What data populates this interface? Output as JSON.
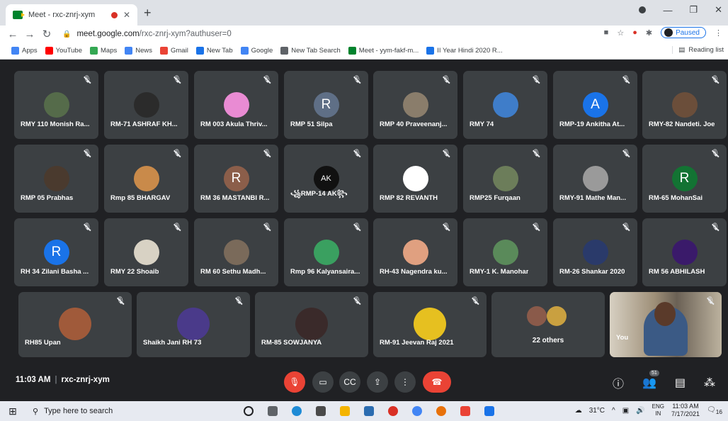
{
  "browser": {
    "tab_title": "Meet - rxc-znrj-xym",
    "url_host": "meet.google.com",
    "url_path": "/rxc-znrj-xym?authuser=0",
    "profile_status": "Paused",
    "bookmarks": [
      {
        "label": "Apps",
        "color": "#4285f4"
      },
      {
        "label": "YouTube",
        "color": "#ff0000"
      },
      {
        "label": "Maps",
        "color": "#34a853"
      },
      {
        "label": "News",
        "color": "#4285f4"
      },
      {
        "label": "Gmail",
        "color": "#ea4335"
      },
      {
        "label": "New Tab",
        "color": "#1a73e8"
      },
      {
        "label": "Google",
        "color": "#4285f4"
      },
      {
        "label": "New Tab Search",
        "color": "#5f6368"
      },
      {
        "label": "Meet - yym-fakf-m...",
        "color": "#00832d"
      },
      {
        "label": "II Year Hindi 2020 R...",
        "color": "#1a73e8"
      }
    ],
    "reading_list": "Reading list"
  },
  "participants": [
    {
      "name": "RMY 110 Monish Ra...",
      "avatar_color": "#556b4a",
      "letter": ""
    },
    {
      "name": "RM-71 ASHRAF KH...",
      "avatar_color": "#2b2b2b",
      "letter": ""
    },
    {
      "name": "RM 003 Akula Thriv...",
      "avatar_color": "#e98bd3",
      "letter": ""
    },
    {
      "name": "RMP 51 Silpa",
      "avatar_color": "#5f6f86",
      "letter": "R"
    },
    {
      "name": "RMP 40 Praveenanj...",
      "avatar_color": "#8a7d6b",
      "letter": ""
    },
    {
      "name": "RMY 74",
      "avatar_color": "#3f7dc9",
      "letter": ""
    },
    {
      "name": "RMP-19 Ankitha At...",
      "avatar_color": "#1a73e8",
      "letter": "A"
    },
    {
      "name": "RMY-82 Nandeti. Joe",
      "avatar_color": "#6b4e3a",
      "letter": ""
    },
    {
      "name": "RMP 05 Prabhas",
      "avatar_color": "#4a3a2e",
      "letter": ""
    },
    {
      "name": "Rmp 85 BHARGAV",
      "avatar_color": "#c98a4a",
      "letter": ""
    },
    {
      "name": "RM 36 MASTANBI R...",
      "avatar_color": "#8b5e4a",
      "letter": "R"
    },
    {
      "name": "꧁RMP-14 AK꧂",
      "avatar_color": "#111111",
      "letter": "AK"
    },
    {
      "name": "RMP 82 REVANTH",
      "avatar_color": "#ffffff",
      "letter": ""
    },
    {
      "name": "RMP25 Furqaan",
      "avatar_color": "#6c7d5a",
      "letter": ""
    },
    {
      "name": "RMY-91 Mathe Man...",
      "avatar_color": "#9a9a9a",
      "letter": ""
    },
    {
      "name": "RM-65 MohanSai",
      "avatar_color": "#137333",
      "letter": "R"
    },
    {
      "name": "RH 34 Zilani Basha ...",
      "avatar_color": "#1a73e8",
      "letter": "R"
    },
    {
      "name": "RMY 22 Shoaib",
      "avatar_color": "#d8d2c4",
      "letter": ""
    },
    {
      "name": "RM 60 Sethu Madh...",
      "avatar_color": "#7a6a5a",
      "letter": ""
    },
    {
      "name": "Rmp 96 Kalyansaira...",
      "avatar_color": "#3aa060",
      "letter": ""
    },
    {
      "name": "RH-43 Nagendra ku...",
      "avatar_color": "#e0a080",
      "letter": ""
    },
    {
      "name": "RMY-1 K. Manohar",
      "avatar_color": "#5a8a5a",
      "letter": ""
    },
    {
      "name": "RM-26 Shankar 2020",
      "avatar_color": "#2a3a6a",
      "letter": ""
    },
    {
      "name": "RM 56 ABHILASH",
      "avatar_color": "#3a1a6a",
      "letter": ""
    }
  ],
  "bottom_row": [
    {
      "name": "RH85 Upan",
      "avatar_color": "#a05a3a"
    },
    {
      "name": "Shaikh Jani RH 73",
      "avatar_color": "#4a3a8a"
    },
    {
      "name": "RM-85 SOWJANYA",
      "avatar_color": "#3a2a2a"
    },
    {
      "name": "RM-91 Jeevan Raj 2021",
      "avatar_color": "#e6c020"
    }
  ],
  "others_label": "22 others",
  "self_label": "You",
  "meeting": {
    "time": "11:03 AM",
    "code": "rxc-znrj-xym",
    "participant_count": "51"
  },
  "taskbar": {
    "search_placeholder": "Type here to search",
    "weather": "31°C",
    "lang_top": "ENG",
    "lang_bottom": "IN",
    "clock_time": "11:03 AM",
    "clock_date": "7/17/2021",
    "notifications": "16"
  }
}
